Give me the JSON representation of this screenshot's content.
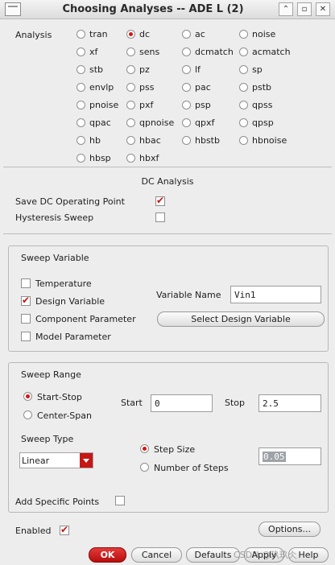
{
  "window": {
    "title": "Choosing Analyses -- ADE L (2)",
    "buttons": [
      "⌃",
      "▫",
      "✕"
    ]
  },
  "analysis": {
    "label": "Analysis",
    "selected": "dc",
    "options": [
      [
        "tran",
        "dc",
        "ac",
        "noise"
      ],
      [
        "xf",
        "sens",
        "dcmatch",
        "acmatch"
      ],
      [
        "stb",
        "pz",
        "lf",
        "sp"
      ],
      [
        "envlp",
        "pss",
        "pac",
        "pstb"
      ],
      [
        "pnoise",
        "pxf",
        "psp",
        "qpss"
      ],
      [
        "qpac",
        "qpnoise",
        "qpxf",
        "qpsp"
      ],
      [
        "hb",
        "hbac",
        "hbstb",
        "hbnoise"
      ],
      [
        "hbsp",
        "hbxf"
      ]
    ]
  },
  "dc_section": {
    "title": "DC Analysis",
    "save_op_label": "Save DC Operating Point",
    "save_op_checked": true,
    "hysteresis_label": "Hysteresis Sweep",
    "hysteresis_checked": false
  },
  "sweep_variable": {
    "title": "Sweep Variable",
    "items": [
      {
        "label": "Temperature",
        "checked": false
      },
      {
        "label": "Design Variable",
        "checked": true
      },
      {
        "label": "Component Parameter",
        "checked": false
      },
      {
        "label": "Model Parameter",
        "checked": false
      }
    ],
    "variable_name_label": "Variable Name",
    "variable_name_value": "Vin1",
    "select_button": "Select Design Variable"
  },
  "sweep_range": {
    "title": "Sweep Range",
    "modes": [
      {
        "label": "Start-Stop",
        "selected": true
      },
      {
        "label": "Center-Span",
        "selected": false
      }
    ],
    "start_label": "Start",
    "start_value": "0",
    "stop_label": "Stop",
    "stop_value": "2.5",
    "sweep_type_label": "Sweep Type",
    "sweep_type_value": "Linear",
    "step_modes": [
      {
        "label": "Step Size",
        "selected": true
      },
      {
        "label": "Number of Steps",
        "selected": false
      }
    ],
    "step_value": "0.05",
    "add_points_label": "Add Specific Points",
    "add_points_checked": false
  },
  "footer": {
    "enabled_label": "Enabled",
    "enabled_checked": true,
    "options_button": "Options...",
    "ok": "OK",
    "cancel": "Cancel",
    "defaults": "Defaults",
    "apply": "Apply",
    "help": "Help"
  },
  "watermark": "CSDN @玖玖仌"
}
